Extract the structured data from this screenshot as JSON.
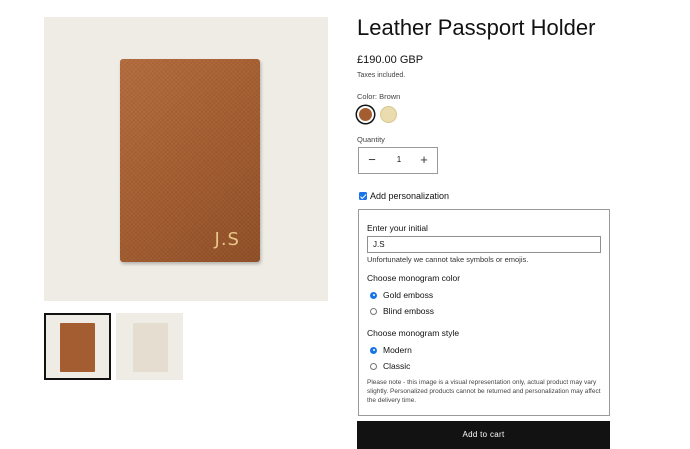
{
  "product": {
    "title": "Leather Passport Holder",
    "price": "£190.00 GBP",
    "tax_note": "Taxes included.",
    "monogram_preview": "J.S"
  },
  "gallery": {
    "images": [
      "brown-passport-holder",
      "cream-passport-holder"
    ],
    "selected_index": 0
  },
  "color": {
    "label": "Color: Brown",
    "options": [
      {
        "name": "Brown",
        "hex": "#a45d30",
        "selected": true
      },
      {
        "name": "Cream",
        "hex": "#eadcae",
        "selected": false
      }
    ]
  },
  "quantity": {
    "label": "Quantity",
    "value": "1",
    "minus": "−",
    "plus": "+"
  },
  "personalization": {
    "checkbox_label": "Add personalization",
    "checked": true,
    "initial_label": "Enter your initial",
    "initial_value": "J.S",
    "hint": "Unfortunately we cannot take symbols or emojis.",
    "color_heading": "Choose monogram color",
    "color_options": [
      "Gold emboss",
      "Blind emboss"
    ],
    "style_heading": "Choose monogram style",
    "style_options": [
      "Modern",
      "Classic"
    ],
    "note": "Please note - this image is a visual representation only, actual product may vary slightly. Personalized products cannot be returned and personalization may affect the delivery time."
  },
  "cart": {
    "button_label": "Add to cart"
  },
  "colors": {
    "accent": "#1a73e8",
    "button_bg": "#121212",
    "leather": "#a45d30"
  }
}
